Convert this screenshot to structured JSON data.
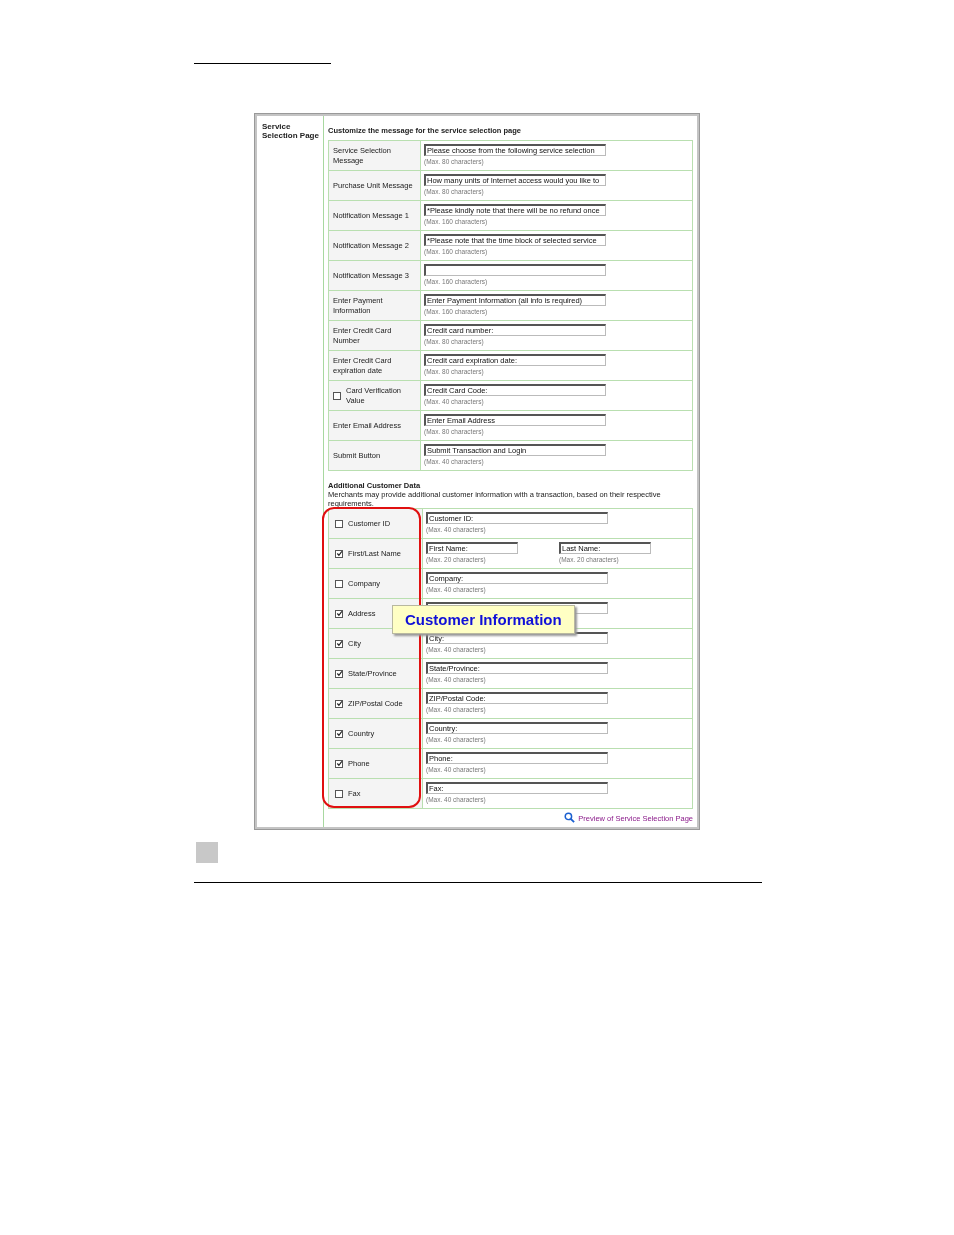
{
  "section": {
    "label": "Service Selection Page",
    "heading": "Customize the message for the service selection page",
    "rows": [
      {
        "kind": "text",
        "label": "Service Selection Message",
        "value": "Please choose from the following service selection",
        "hint": "(Max. 80 characters)"
      },
      {
        "kind": "text",
        "label": "Purchase Unit Message",
        "value": "How many units of Internet access would you like to",
        "hint": "(Max. 80 characters)"
      },
      {
        "kind": "text",
        "label": "Notification Message 1",
        "value": "*Please kindly note that there will be no refund once",
        "hint": "(Max. 160 characters)"
      },
      {
        "kind": "text",
        "label": "Notification Message 2",
        "value": "*Please note that the time block of selected service",
        "hint": "(Max. 160 characters)"
      },
      {
        "kind": "text",
        "label": "Notification Message 3",
        "hint": "(Max. 160 characters)"
      },
      {
        "kind": "text",
        "label": "Enter Payment Information",
        "value": "Enter Payment Information (all info is required)",
        "hint": "(Max. 160 characters)"
      },
      {
        "kind": "text",
        "label": "Enter Credit Card Number",
        "value": "Credit card number:",
        "hint": "(Max. 80 characters)"
      },
      {
        "kind": "text",
        "label": "Enter Credit Card expiration date",
        "value": "Credit card expiration date:",
        "hint": "(Max. 80 characters)"
      },
      {
        "kind": "checkbox",
        "checked": false,
        "label": "Card Verification Value",
        "value": "Credit Card Code:",
        "hint": "(Max. 40 characters)"
      },
      {
        "kind": "text",
        "label": "Enter Email Address",
        "value": "Enter Email Address",
        "hint": "(Max. 80 characters)"
      },
      {
        "kind": "text",
        "label": "Submit Button",
        "value": "Submit Transaction and Login",
        "hint": "(Max. 40 characters)"
      }
    ]
  },
  "additional": {
    "title": "Additional Customer Data",
    "description": "Merchants may provide additional customer information with a transaction, based on their respective requirements.",
    "rows": [
      {
        "label": "Customer ID",
        "checked": false,
        "fields": [
          {
            "value": "Customer ID:",
            "hint": "(Max. 40 characters)"
          }
        ]
      },
      {
        "label": "First/Last Name",
        "checked": true,
        "fields": [
          {
            "value": "First Name:",
            "hint": "(Max. 20 characters)"
          },
          {
            "value": "Last Name:",
            "hint": "(Max. 20 characters)"
          }
        ]
      },
      {
        "label": "Company",
        "checked": false,
        "fields": [
          {
            "value": "Company:",
            "hint": "(Max. 40 characters)"
          }
        ]
      },
      {
        "label": "Address",
        "checked": true,
        "fields": [
          {
            "kind": "field"
          }
        ]
      },
      {
        "label": "City",
        "checked": true,
        "fields": [
          {
            "value": "City:",
            "hint": "(Max. 40 characters)"
          }
        ]
      },
      {
        "label": "State/Province",
        "checked": true,
        "fields": [
          {
            "value": "State/Province:",
            "hint": "(Max. 40 characters)"
          }
        ]
      },
      {
        "label": "ZIP/Postal Code",
        "checked": true,
        "fields": [
          {
            "value": "ZIP/Postal Code:",
            "hint": "(Max. 40 characters)"
          }
        ]
      },
      {
        "label": "Country",
        "checked": true,
        "fields": [
          {
            "value": "Country:",
            "hint": "(Max. 40 characters)"
          }
        ]
      },
      {
        "label": "Phone",
        "checked": true,
        "fields": [
          {
            "value": "Phone:",
            "hint": "(Max. 40 characters)"
          }
        ]
      },
      {
        "label": "Fax",
        "checked": false,
        "fields": [
          {
            "value": "Fax:",
            "hint": "(Max. 40 characters)"
          }
        ]
      }
    ]
  },
  "callout": "Customer Information",
  "preview_link": "Preview of Service Selection Page"
}
